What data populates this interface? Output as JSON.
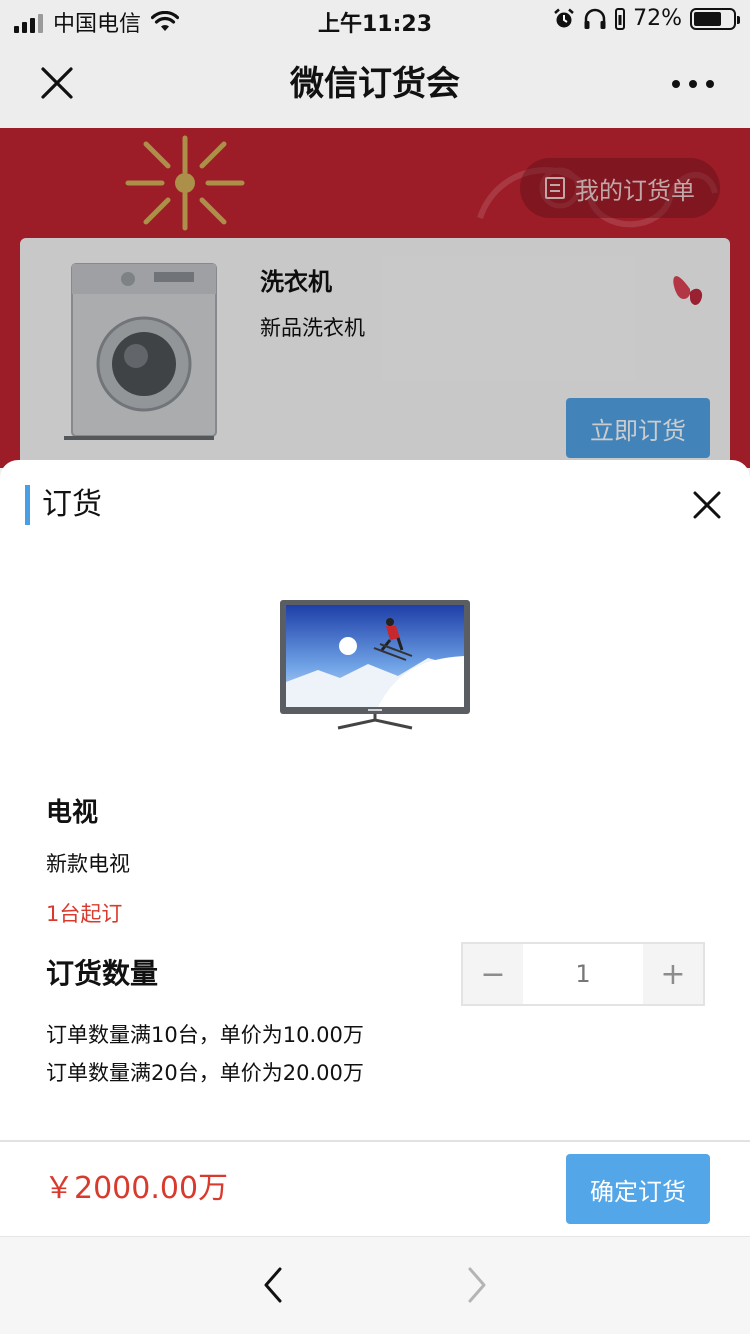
{
  "status_bar": {
    "carrier": "中国电信",
    "time": "上午11:23",
    "battery": "72%",
    "battery_level": 0.72
  },
  "nav": {
    "title": "微信订货会",
    "close_icon": "close-icon",
    "more_icon": "more-icon"
  },
  "background_page": {
    "my_orders_label": "我的订货单",
    "product": {
      "name": "洗衣机",
      "desc": "新品洗衣机",
      "order_label": "立即订货"
    }
  },
  "sheet": {
    "title": "订货",
    "product": {
      "name": "电视",
      "desc": "新款电视",
      "min_order": "1台起订"
    },
    "quantity_label": "订货数量",
    "quantity": "1",
    "minus": "−",
    "plus": "+",
    "tiers": [
      "订单数量满10台，单价为10.00万",
      "订单数量满20台，单价为20.00万"
    ],
    "total": "￥2000.00万",
    "confirm_label": "确定订货"
  },
  "colors": {
    "accent": "#53a6e8",
    "price": "#d83b2e",
    "banner": "#c42431"
  }
}
